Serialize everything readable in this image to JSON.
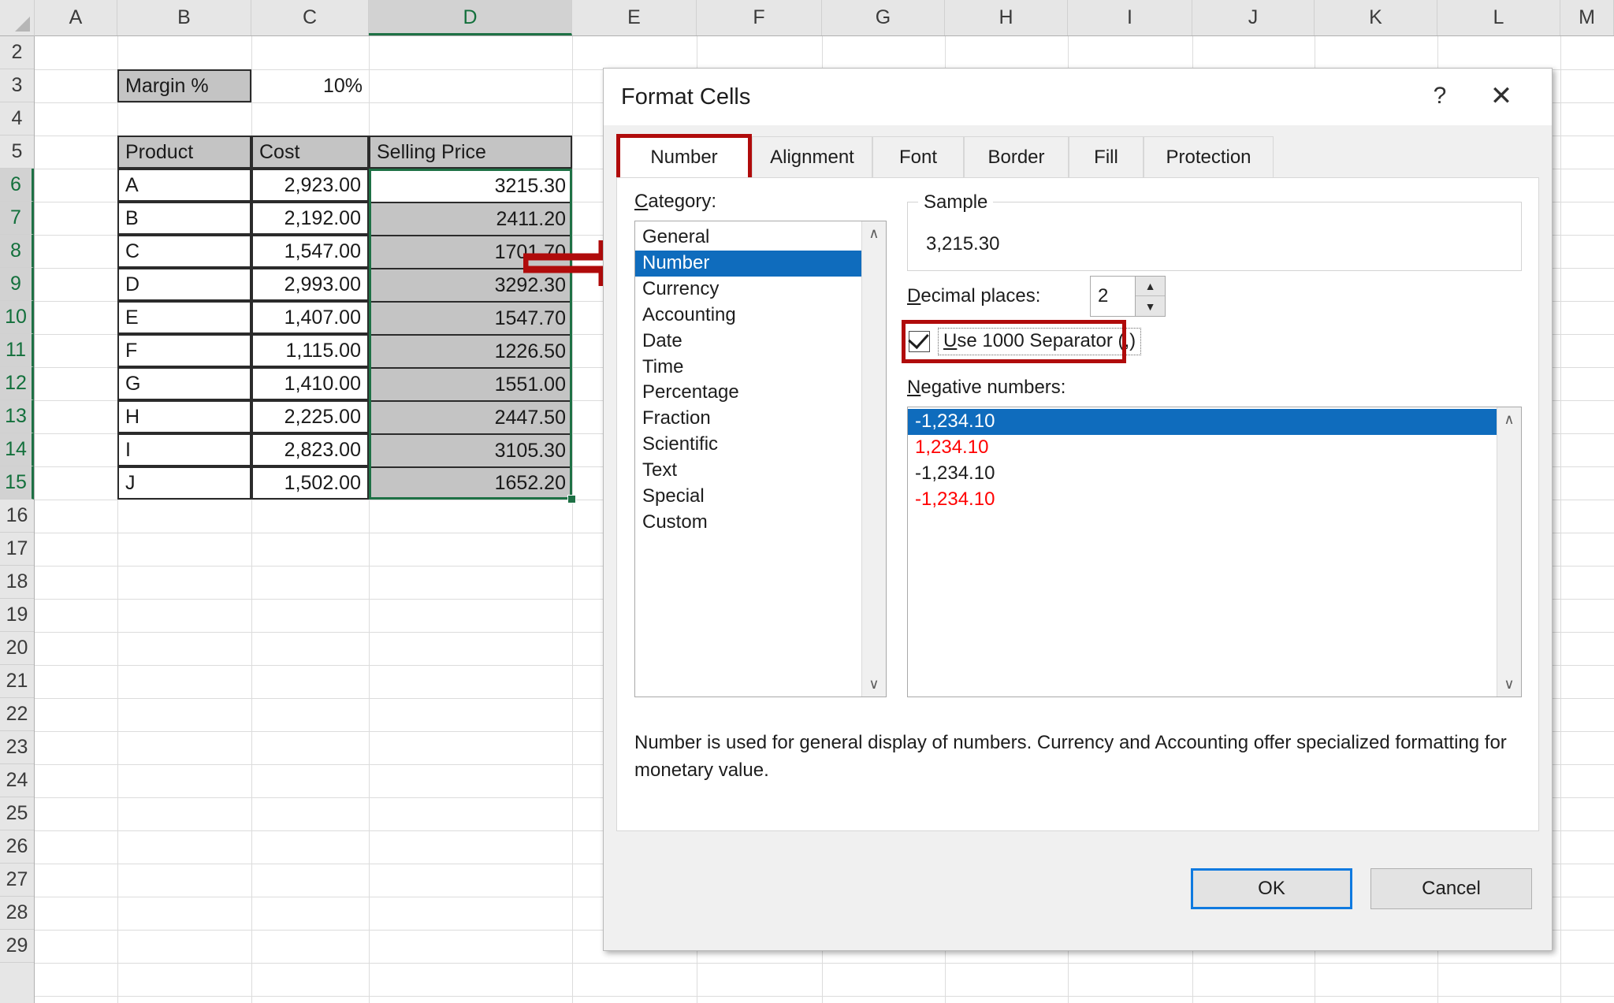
{
  "spreadsheet": {
    "columns": [
      "A",
      "B",
      "C",
      "D",
      "E",
      "F",
      "G",
      "H",
      "I",
      "J",
      "K",
      "L",
      "M"
    ],
    "selected_column": "D",
    "rows": [
      "2",
      "3",
      "4",
      "5",
      "6",
      "7",
      "8",
      "9",
      "10",
      "11",
      "12",
      "13",
      "14",
      "15",
      "16",
      "17",
      "18",
      "19",
      "20",
      "21",
      "22",
      "23",
      "24",
      "25",
      "26",
      "27",
      "28",
      "29"
    ],
    "selected_rows": [
      "6",
      "7",
      "8",
      "9",
      "10",
      "11",
      "12",
      "13",
      "14",
      "15"
    ],
    "margin_label": "Margin %",
    "margin_value": "10%",
    "table_headers": [
      "Product",
      "Cost",
      "Selling Price"
    ],
    "table_rows": [
      {
        "product": "A",
        "cost": "2,923.00",
        "selling_price": "3215.30"
      },
      {
        "product": "B",
        "cost": "2,192.00",
        "selling_price": "2411.20"
      },
      {
        "product": "C",
        "cost": "1,547.00",
        "selling_price": "1701.70"
      },
      {
        "product": "D",
        "cost": "2,993.00",
        "selling_price": "3292.30"
      },
      {
        "product": "E",
        "cost": "1,407.00",
        "selling_price": "1547.70"
      },
      {
        "product": "F",
        "cost": "1,115.00",
        "selling_price": "1226.50"
      },
      {
        "product": "G",
        "cost": "1,410.00",
        "selling_price": "1551.00"
      },
      {
        "product": "H",
        "cost": "2,225.00",
        "selling_price": "2447.50"
      },
      {
        "product": "I",
        "cost": "2,823.00",
        "selling_price": "3105.30"
      },
      {
        "product": "J",
        "cost": "1,502.00",
        "selling_price": "1652.20"
      }
    ]
  },
  "dialog": {
    "title": "Format Cells",
    "help_icon": "?",
    "close_icon": "✕",
    "tabs": [
      {
        "label": "Number",
        "active": true
      },
      {
        "label": "Alignment",
        "active": false
      },
      {
        "label": "Font",
        "active": false
      },
      {
        "label": "Border",
        "active": false
      },
      {
        "label": "Fill",
        "active": false
      },
      {
        "label": "Protection",
        "active": false
      }
    ],
    "category_label": "Category:",
    "categories": [
      "General",
      "Number",
      "Currency",
      "Accounting",
      "Date",
      "Time",
      "Percentage",
      "Fraction",
      "Scientific",
      "Text",
      "Special",
      "Custom"
    ],
    "selected_category": "Number",
    "sample_legend": "Sample",
    "sample_value": "3,215.30",
    "decimal_places_label": "Decimal places:",
    "decimal_places_value": "2",
    "use_1000_separator_label": "Use 1000 Separator (,)",
    "use_1000_separator_checked": true,
    "negative_numbers_label": "Negative numbers:",
    "negative_numbers": [
      {
        "text": "-1,234.10",
        "color": "black",
        "selected": true
      },
      {
        "text": "1,234.10",
        "color": "red",
        "selected": false
      },
      {
        "text": "-1,234.10",
        "color": "black",
        "selected": false
      },
      {
        "text": "-1,234.10",
        "color": "red",
        "selected": false
      }
    ],
    "description": "Number is used for general display of numbers.  Currency and Accounting offer specialized formatting for monetary value.",
    "ok_label": "OK",
    "cancel_label": "Cancel",
    "scroll_up_icon": "∧",
    "scroll_down_icon": "∨",
    "spin_up_icon": "▲",
    "spin_down_icon": "▼"
  },
  "annotations": {
    "arrow_color": "#b00b0b",
    "tab_highlight_color": "#b00b0b",
    "checkbox_highlight_color": "#b00b0b",
    "selection_color": "#1e7145",
    "list_selection_color": "#0f6cbd"
  }
}
